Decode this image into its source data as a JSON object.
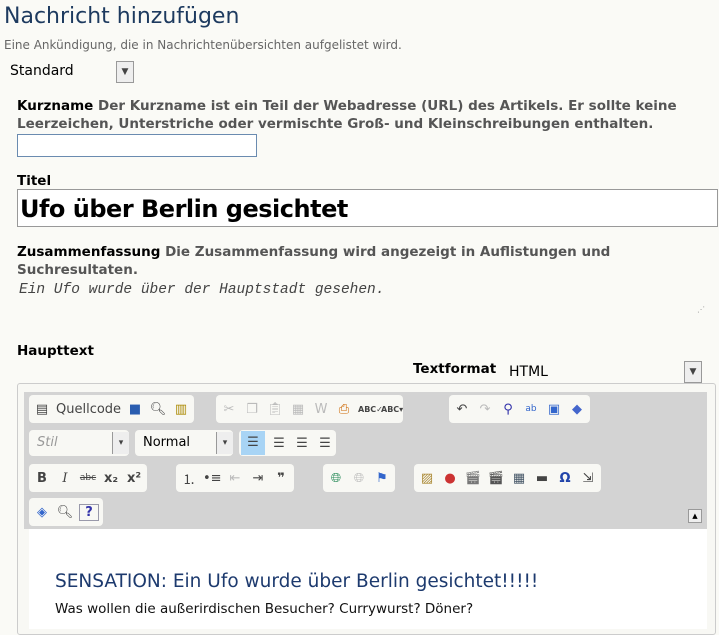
{
  "page": {
    "title": "Nachricht hinzufügen",
    "subtitle": "Eine Ankündigung, die in Nachrichtenübersichten aufgelistet wird.",
    "layout_select": "Standard"
  },
  "kurzname": {
    "label": "Kurzname",
    "help": "Der Kurzname ist ein Teil der Webadresse (URL) des Artikels. Er sollte keine Leerzeichen, Unterstriche oder vermischte Groß- und Kleinschreibungen enthalten.",
    "value": ""
  },
  "titel": {
    "label": "Titel",
    "value": "Ufo über Berlin gesichtet"
  },
  "zusammenfassung": {
    "label": "Zusammenfassung",
    "help": "Die Zusammenfassung wird angezeigt in Auflistungen und Suchresultaten.",
    "value": "Ein Ufo wurde über der Hauptstadt gesehen."
  },
  "haupttext": {
    "label": "Haupttext",
    "textformat_label": "Textformat",
    "textformat_value": "HTML"
  },
  "toolbar": {
    "source": "Quellcode",
    "style": "Stil",
    "format": "Normal"
  },
  "content": {
    "heading": "SENSATION: Ein Ufo wurde über Berlin gesichtet!!!!!",
    "paragraph": "Was wollen die außerirdischen Besucher? Currywurst? Döner?"
  },
  "colors": {
    "title": "#1d3a5f",
    "heading": "#1d3a6e",
    "toolbar_bg": "#d3d3d3",
    "active_button": "#a8d4f5"
  }
}
